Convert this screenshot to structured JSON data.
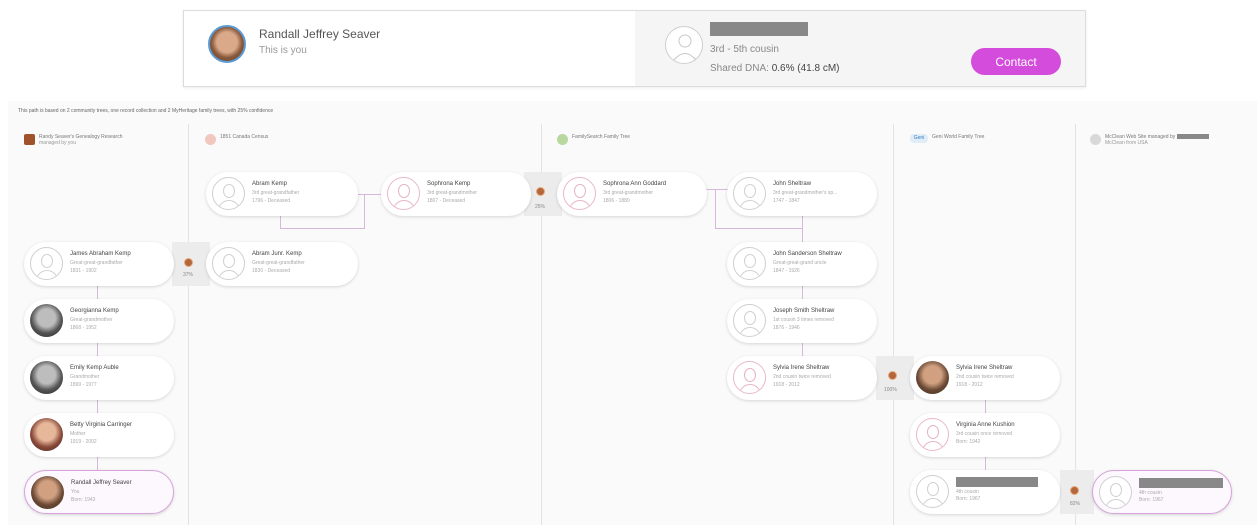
{
  "header": {
    "you_name": "Randall Jeffrey Seaver",
    "you_sub": "This is you",
    "match_relationship": "3rd - 5th cousin",
    "shared_dna_label": "Shared DNA: ",
    "shared_dna_value": "0.6% (41.8 cM)",
    "contact_label": "Contact"
  },
  "confidence_note": "This path is based on 2 community trees, one record collection and 2 MyHeritage family trees, with 25% confidence",
  "columns": [
    {
      "title": "Randy Seaver's Genealogy Research",
      "sub": "managed by you",
      "icon": "crest-icon"
    },
    {
      "title": "1851 Canada Census",
      "icon": "census-icon"
    },
    {
      "title": "FamilySearch Family Tree",
      "icon": "familysearch-icon"
    },
    {
      "title": "Geni World Family Tree",
      "icon_text": "Geni",
      "icon": "geni-icon"
    },
    {
      "title": "McClean Web Site",
      "title_suffix": "managed by",
      "sub": "McClean from USA",
      "icon": "website-icon"
    }
  ],
  "people": {
    "james_kemp": {
      "name": "James Abraham Kemp",
      "rel": "Great-great-grandfather",
      "dates": "1831 - 1902"
    },
    "georgianna": {
      "name": "Georgianna Kemp",
      "rel": "Great-grandmother",
      "dates": "1868 - 1952"
    },
    "emily": {
      "name": "Emily Kemp Auble",
      "rel": "Grandmother",
      "dates": "1899 - 1977"
    },
    "betty": {
      "name": "Betty Virginia Carringer",
      "rel": "Mother",
      "dates": "1919 - 2002"
    },
    "randall": {
      "name": "Randall Jeffrey Seaver",
      "rel": "You",
      "dates": "Born: 1943"
    },
    "abram_kemp": {
      "name": "Abram Kemp",
      "rel": "3rd great-grandfather",
      "dates": "1796 - Deceased"
    },
    "abram_junr": {
      "name": "Abram Junr. Kemp",
      "rel": "Great-great-grandfather",
      "dates": "1830 - Deceased"
    },
    "sophrona_kemp": {
      "name": "Sophrona Kemp",
      "rel": "3rd great-grandmother",
      "dates": "1807 - Deceased"
    },
    "sophrona_goddard": {
      "name": "Sophrona Ann Goddard",
      "rel": "3rd great-grandmother",
      "dates": "1806 - 1880"
    },
    "john_sheltraw": {
      "name": "John Sheltraw",
      "rel": "3rd great-grandmother's sp...",
      "dates": "1747 - 1847"
    },
    "john_sanderson": {
      "name": "John Sanderson Sheltraw",
      "rel": "Great-great-grand uncle",
      "dates": "1847 - 1926"
    },
    "joseph_smith": {
      "name": "Joseph Smith Sheltraw",
      "rel": "1st cousin 3 times removed",
      "dates": "1876 - 1946"
    },
    "sylvia_fs": {
      "name": "Sylvia Irene Sheltraw",
      "rel": "2nd cousin twice removed",
      "dates": "1918 - 2012"
    },
    "sylvia_geni": {
      "name": "Sylvia Irene Sheltraw",
      "rel": "2nd cousin twice removed",
      "dates": "1918 - 2012"
    },
    "virginia": {
      "name": "Virginia Anne Kushion",
      "rel": "3rd cousin once removed",
      "dates": "Born: 1942"
    },
    "cousin_geni": {
      "rel": "4th cousin",
      "dates": "Born: 1967"
    },
    "cousin_mcc": {
      "rel": "4th cousin",
      "dates": "Born: 1967"
    }
  },
  "matches": {
    "m1": "37%",
    "m2": "25%",
    "m3": "100%",
    "m4": "82%"
  }
}
